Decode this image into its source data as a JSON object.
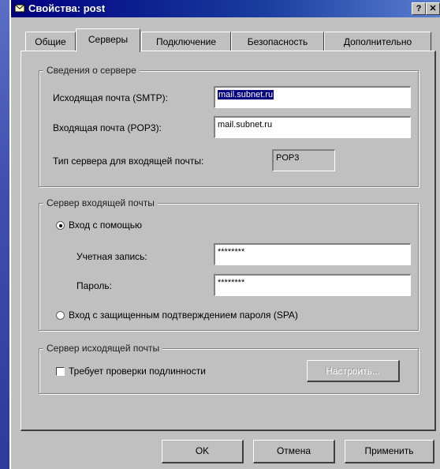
{
  "window": {
    "title": "Свойства: post",
    "help_label": "?",
    "close_label": "✕",
    "icon": "mail-properties-icon"
  },
  "tabs": [
    {
      "label": "Общие",
      "active": false
    },
    {
      "label": "Серверы",
      "active": true
    },
    {
      "label": "Подключение",
      "active": false
    },
    {
      "label": "Безопасность",
      "active": false
    },
    {
      "label": "Дополнительно",
      "active": false
    }
  ],
  "server_info": {
    "legend": "Сведения о сервере",
    "smtp_label": "Исходящая почта (SMTP):",
    "smtp_value": "mail.subnet.ru",
    "pop3_label": "Входящая почта (POP3):",
    "pop3_value": "mail.subnet.ru",
    "type_label": "Тип сервера для входящей почты:",
    "type_value": "POP3"
  },
  "incoming": {
    "legend": "Сервер входящей почты",
    "login_radio": "Вход с помощью",
    "account_label": "Учетная запись:",
    "account_value": "********",
    "password_label": "Пароль:",
    "password_value": "********",
    "spa_radio": "Вход с защищенным подтверждением пароля (SPA)",
    "selected": "login"
  },
  "outgoing": {
    "legend": "Сервер исходящей почты",
    "auth_check": "Требует проверки подлинности",
    "auth_checked": false,
    "settings_button": "Настроить..."
  },
  "buttons": {
    "ok": "OK",
    "cancel": "Отмена",
    "apply": "Применить"
  }
}
